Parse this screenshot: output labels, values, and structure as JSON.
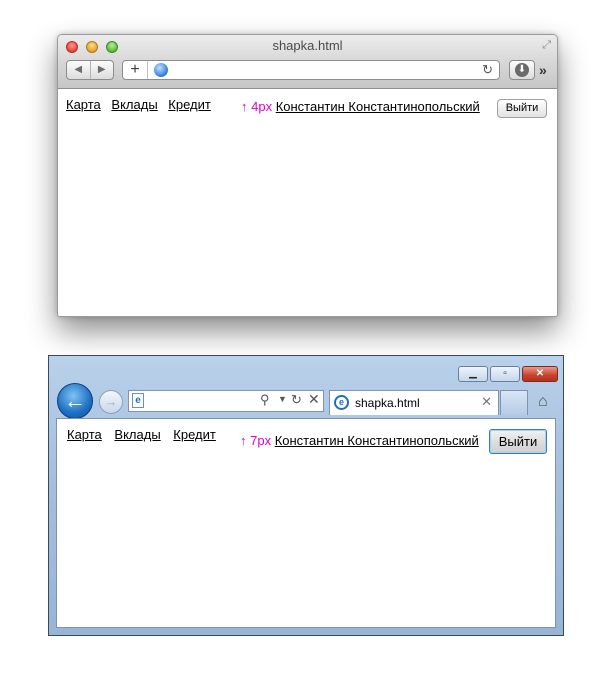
{
  "safari": {
    "title": "shapka.html",
    "url": "",
    "nav": [
      "Карта",
      "Вклады",
      "Кредит"
    ],
    "note": "↑ 4px",
    "user": "Константин Константинопольский",
    "logout": "Выйти"
  },
  "ie": {
    "url": "",
    "tab_title": "shapka.html",
    "nav": [
      "Карта",
      "Вклады",
      "Кредит"
    ],
    "note": "↑ 7px",
    "user": "Константин Константинопольский",
    "logout": "Выйти"
  },
  "colors": {
    "note": "#e000d0",
    "ie_frame": "#b9d1ea",
    "ie_back_button": "#1e6fc3"
  },
  "icons": {
    "safari": [
      "close-icon",
      "minimize-icon",
      "zoom-icon",
      "fullscreen-icon",
      "back-icon",
      "forward-icon",
      "plus-icon",
      "globe-icon",
      "reload-icon",
      "download-icon",
      "more-icon"
    ],
    "ie": [
      "minimize-icon",
      "maximize-icon",
      "close-icon",
      "back-icon",
      "forward-icon",
      "page-icon",
      "search-icon",
      "dropdown-icon",
      "refresh-icon",
      "stop-icon",
      "ie-logo-icon",
      "home-icon"
    ]
  }
}
